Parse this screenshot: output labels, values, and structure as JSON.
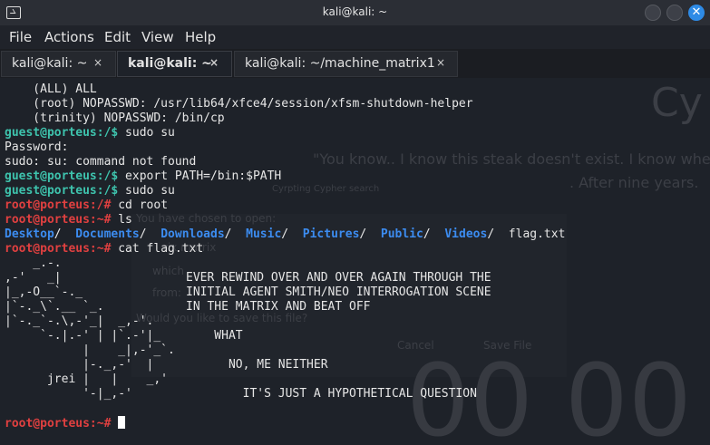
{
  "window": {
    "title": "kali@kali: ~",
    "close_glyph": "✕"
  },
  "menu": [
    "File",
    "Actions",
    "Edit",
    "View",
    "Help"
  ],
  "tabs": [
    {
      "label": "kali@kali: ~",
      "close": "×",
      "active": false
    },
    {
      "label": "kali@kali: ~",
      "close": "×",
      "active": true
    },
    {
      "label": "kali@kali: ~/machine_matrix1",
      "close": "×",
      "active": false
    }
  ],
  "background_dialog": {
    "heading": "Cy",
    "quote_line1": "\"You know.. I know this steak doesn't exist. I know whe",
    "quote_line2": ". After nine years.",
    "crypto": "Cyrpting Cypher search",
    "save_prompt": "You have chosen to open:",
    "file_label": "rix matrix",
    "which_label": "which",
    "from_label": "from:",
    "save_q": "Would you like to save this file?",
    "cancel": "Cancel",
    "save_file": "Save File",
    "timer": "00 00"
  },
  "terminal": {
    "lines": [
      {
        "type": "plain",
        "text": "    (ALL) ALL"
      },
      {
        "type": "plain",
        "text": "    (root) NOPASSWD: /usr/lib64/xfce4/session/xfsm-shutdown-helper"
      },
      {
        "type": "plain",
        "text": "    (trinity) NOPASSWD: /bin/cp"
      },
      {
        "type": "guest",
        "prompt": "guest@porteus:/$",
        "cmd": " sudo su"
      },
      {
        "type": "plain",
        "text": "Password:"
      },
      {
        "type": "plain",
        "text": "sudo: su: command not found"
      },
      {
        "type": "guest",
        "prompt": "guest@porteus:/$",
        "cmd": " export PATH=/bin:$PATH"
      },
      {
        "type": "guest",
        "prompt": "guest@porteus:/$",
        "cmd": " sudo su"
      },
      {
        "type": "root",
        "prompt": "root@porteus:/#",
        "cmd": " cd root"
      },
      {
        "type": "root",
        "prompt": "root@porteus:~#",
        "cmd": " ls"
      },
      {
        "type": "ls"
      },
      {
        "type": "root",
        "prompt": "root@porteus:~#",
        "cmd": " cat flag.txt"
      }
    ],
    "ls_items": [
      {
        "name": "Desktop",
        "dir": true
      },
      {
        "name": "Documents",
        "dir": true
      },
      {
        "name": "Downloads",
        "dir": true
      },
      {
        "name": "Music",
        "dir": true
      },
      {
        "name": "Pictures",
        "dir": true
      },
      {
        "name": "Public",
        "dir": true
      },
      {
        "name": "Videos",
        "dir": true
      },
      {
        "name": "flag.txt",
        "dir": false
      }
    ],
    "ascii_art": [
      "    _.-.",
      ",-'   _|",
      "|_,-O__`-._",
      "|`-._\\`.__ `_.",
      "|`-._`-.\\,-'_|  _,-'.",
      "     `-.|.-' | |`.-'|_",
      "           |    _|,-'_`.",
      "           |-._,-'  |",
      "      jrei |   |    _,'",
      "           '-|_,-'"
    ],
    "flag_lines": [
      "EVER REWIND OVER AND OVER AGAIN THROUGH THE",
      "INITIAL AGENT SMITH/NEO INTERROGATION SCENE",
      "IN THE MATRIX AND BEAT OFF",
      "",
      "    WHAT",
      "",
      "      NO, ME NEITHER",
      "",
      "        IT'S JUST A HYPOTHETICAL QUESTION"
    ],
    "final_prompt": "root@porteus:~#"
  }
}
